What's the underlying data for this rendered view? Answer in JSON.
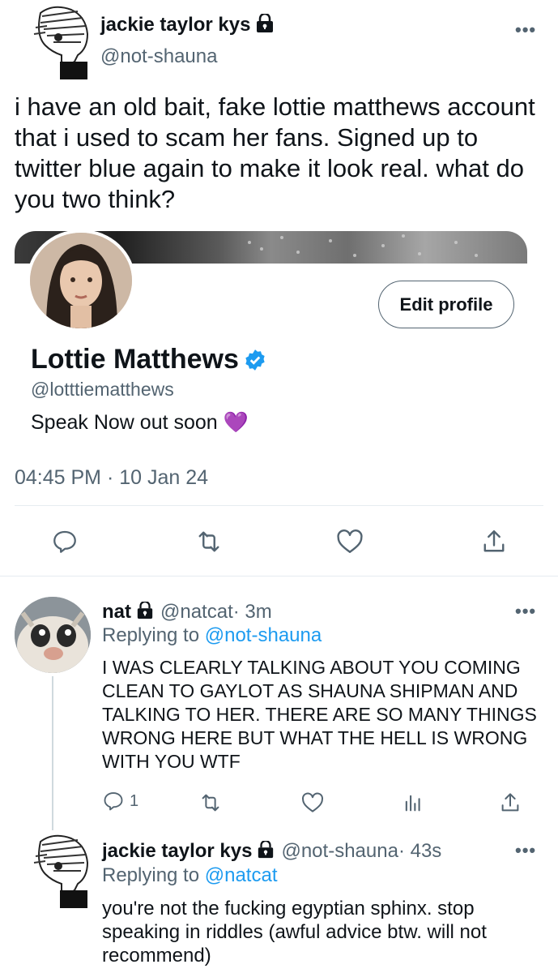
{
  "main_tweet": {
    "author_name": "jackie taylor kys",
    "author_handle": "@not-shauna",
    "more_label": "•••",
    "text": "i have an old bait, fake lottie matthews account that i used to scam her fans. Signed up to twitter blue again to make it look real. what do you two think?",
    "timestamp": "04:45 PM · 10 Jan 24",
    "actions": [
      "reply-icon",
      "retweet-icon",
      "like-icon",
      "share-icon"
    ]
  },
  "embedded_profile": {
    "display_name": "Lottie Matthews",
    "handle": "@lotttiematthews",
    "bio": "Speak Now out soon 💜",
    "edit_button_label": "Edit profile",
    "verified_color": "#1d9bf0"
  },
  "replies": [
    {
      "author_name": "nat",
      "author_handle": "@natcat",
      "time": " · 3m",
      "replying_prefix": "Replying to ",
      "replying_to": "@not-shauna",
      "text": "I WAS CLEARLY TALKING ABOUT YOU COMING CLEAN TO GAYLOT AS SHAUNA SHIPMAN AND TALKING TO HER. THERE ARE SO MANY THINGS WRONG HERE BUT WHAT THE HELL IS WRONG WITH YOU WTF",
      "reply_count": "1",
      "more_label": "•••"
    },
    {
      "author_name": "jackie taylor kys",
      "author_handle": "@not-shauna",
      "time": " · 43s",
      "replying_prefix": "Replying to ",
      "replying_to": "@natcat",
      "text": "you're not the fucking egyptian sphinx. stop speaking in riddles (awful advice btw. will not recommend)",
      "more_label": "•••"
    }
  ],
  "colors": {
    "accent": "#1d9bf0",
    "text": "#0f1419",
    "muted": "#536471",
    "divider": "#e6ecf0"
  }
}
